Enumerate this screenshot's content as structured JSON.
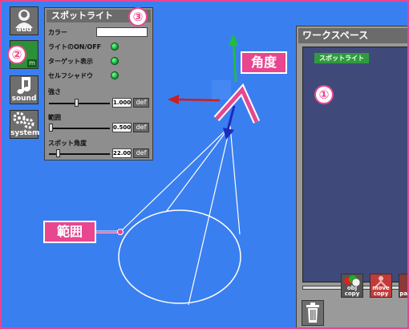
{
  "toolbar": {
    "add_label": "add",
    "sound_label": "sound",
    "system_label": "system",
    "object_label": "m"
  },
  "spotlight_panel": {
    "title": "スポットライト",
    "color_label": "カラー",
    "toggles": [
      {
        "label": "ライトのON/OFF",
        "on": true
      },
      {
        "label": "ターゲット表示",
        "on": true
      },
      {
        "label": "セルフシャドウ",
        "on": true
      }
    ],
    "sliders": [
      {
        "label": "強さ",
        "value": "1.000",
        "fraction": 0.45,
        "def_label": "def"
      },
      {
        "label": "範囲",
        "value": "0.500",
        "fraction": 0.0,
        "def_label": "def"
      },
      {
        "label": "スポット角度",
        "value": "22.00",
        "fraction": 0.12,
        "def_label": "def"
      }
    ]
  },
  "workspace": {
    "title": "ワークスペース",
    "items": [
      "スポットライト"
    ],
    "buttons": [
      {
        "top": "obj",
        "bottom": "copy"
      },
      {
        "top": "move",
        "bottom": "copy"
      },
      {
        "top": "par",
        "bottom": ""
      }
    ],
    "trash_label": "delete"
  },
  "annotations": {
    "angle_label": "角度",
    "range_label": "範囲",
    "markers": [
      "①",
      "②",
      "③"
    ]
  },
  "colors": {
    "background": "#3a7ff0",
    "accent_pink": "#e8468f",
    "toggle_green": "#13a83a",
    "axis_green": "#1fbf3c",
    "axis_red": "#cc1f1f",
    "axis_blue": "#1a2bbf"
  }
}
